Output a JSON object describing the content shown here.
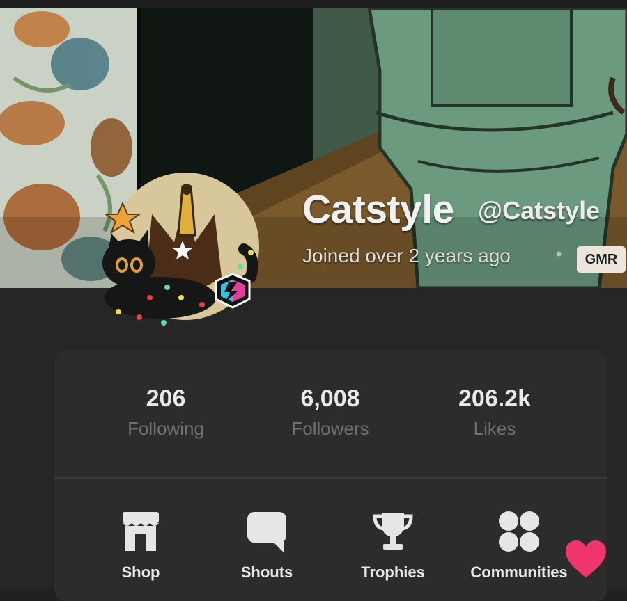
{
  "profile": {
    "display_name": "Catstyle",
    "handle": "@Catstyle",
    "joined": "Joined over 2 years ago",
    "separator": "•",
    "badge": "GMR"
  },
  "stats": [
    {
      "value": "206",
      "label": "Following"
    },
    {
      "value": "6,008",
      "label": "Followers"
    },
    {
      "value": "206.2k",
      "label": "Likes"
    }
  ],
  "nav": [
    {
      "label": "Shop",
      "icon": "shop-icon"
    },
    {
      "label": "Shouts",
      "icon": "speech-bubble-icon"
    },
    {
      "label": "Trophies",
      "icon": "trophy-icon"
    },
    {
      "label": "Communities",
      "icon": "communities-icon"
    }
  ],
  "floating_action": {
    "icon": "heart-icon"
  },
  "colors": {
    "background": "#212121",
    "card": "#2c2c2c",
    "badge_bg": "#ece5dc",
    "heart": "#f0356b",
    "stat_label": "#6f6f6f"
  }
}
